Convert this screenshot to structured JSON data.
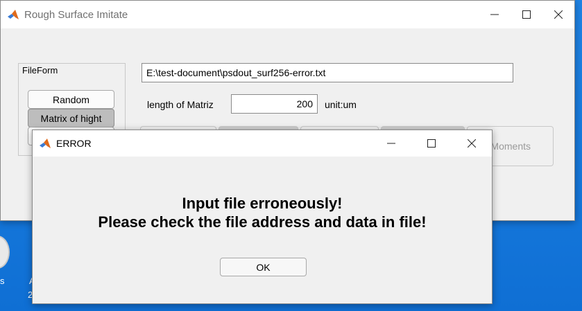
{
  "main_window": {
    "title": "Rough Surface Imitate",
    "file_path": "E:\\test-document\\psdout_surf256-error.txt",
    "panel": {
      "title": "FileForm",
      "buttons": [
        "Random",
        "Matrix of hight",
        ""
      ]
    },
    "length_label": "length of Matriz",
    "length_value": "200",
    "unit_label": "unit:um",
    "tabs": [
      "",
      "",
      "",
      "",
      "Moments"
    ]
  },
  "dialog": {
    "title": "ERROR",
    "message_line1": "Input file erroneously!",
    "message_line2": "Please check the file address and data in file!",
    "ok_label": "OK"
  },
  "desktop": {
    "partial_labels": [
      "s",
      "A",
      "2"
    ]
  },
  "colors": {
    "desktop_bg": "#1f84e6",
    "window_bg": "#f0f0f0",
    "titlebar_bg": "#ffffff",
    "pressed_button": "#bdbdbd"
  },
  "icons": [
    "matlab-logo-icon",
    "minimize-icon",
    "maximize-icon",
    "close-icon"
  ]
}
